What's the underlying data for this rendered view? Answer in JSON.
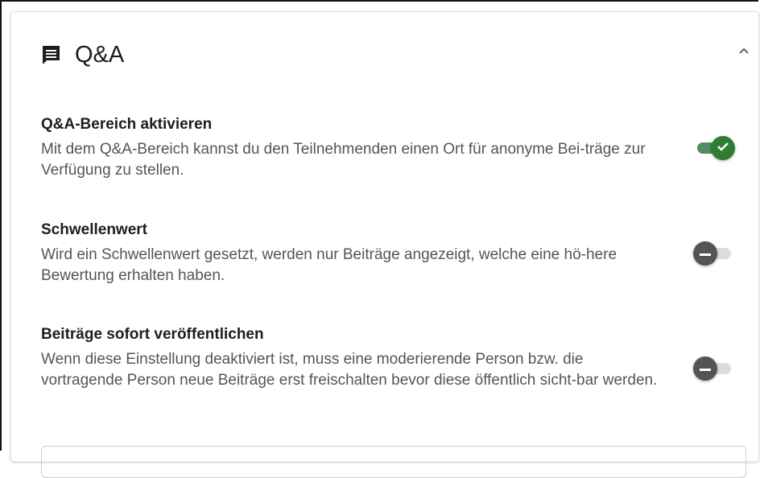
{
  "panel": {
    "title": "Q&A",
    "header_icon": "forum-icon",
    "collapse_icon": "chevron-up-icon"
  },
  "settings": [
    {
      "title": "Q&A-Bereich aktivieren",
      "description": "Mit dem Q&A-Bereich kannst du den Teilnehmenden einen Ort für anonyme Bei-träge zur Verfügung zu stellen.",
      "enabled": true
    },
    {
      "title": "Schwellenwert",
      "description": "Wird ein Schwellenwert gesetzt, werden nur Beiträge angezeigt, welche eine hö-here Bewertung erhalten haben.",
      "enabled": false
    },
    {
      "title": "Beiträge sofort veröffentlichen",
      "description": "Wenn diese Einstellung deaktiviert ist, muss eine moderierende Person bzw. die vortragende Person neue Beiträge erst freischalten bevor diese öffentlich sicht-bar werden.",
      "enabled": false
    }
  ],
  "colors": {
    "toggle_on_thumb": "#2e7d32",
    "toggle_on_track": "#4f8f66",
    "toggle_off_thumb": "#545454",
    "toggle_off_track": "#dcdcdc"
  }
}
